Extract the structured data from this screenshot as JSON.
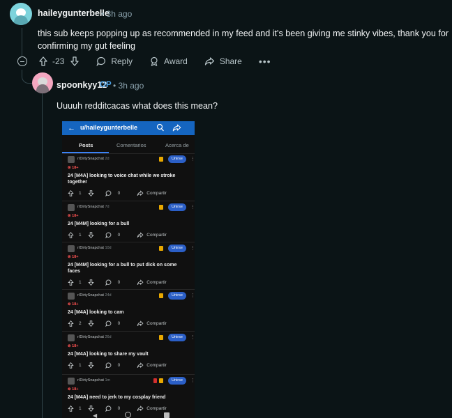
{
  "comment1": {
    "username": "haileygunterbelle",
    "time": "• 3h ago",
    "text": "this sub keeps popping up as recommended in my feed and it's been giving me stinky vibes, thank you for confirming my gut feeling",
    "score": "-23",
    "reply_label": "Reply",
    "award_label": "Award",
    "share_label": "Share",
    "more_label": "•••"
  },
  "comment2": {
    "username": "spoonkyy12",
    "op_badge": "OP",
    "time": "• 3h ago",
    "text": "Uuuuh redditcacas what does this mean?"
  },
  "screenshot": {
    "back": "←",
    "username": "u/haileygunterbelle",
    "tabs": [
      "Posts",
      "Comentarios",
      "Acerca de"
    ],
    "posts": [
      {
        "sub": "r/DirtySnapchat",
        "age": "2d",
        "nsfw": "⊗ 18+",
        "title": "24 [M4A] looking to voice chat while we stroke together",
        "votes": "1",
        "comments": "0",
        "share": "Compartir",
        "join": "Unirse"
      },
      {
        "sub": "r/DirtySnapchat",
        "age": "7d",
        "nsfw": "⊗ 18+",
        "title": "24 [M4M] looking for a bull",
        "votes": "1",
        "comments": "0",
        "share": "Compartir",
        "join": "Unirse"
      },
      {
        "sub": "r/DirtySnapchat",
        "age": "10d",
        "nsfw": "⊗ 18+",
        "title": "24 [M4M] looking for a bull to put dick on some faces",
        "votes": "1",
        "comments": "0",
        "share": "Compartir",
        "join": "Unirse"
      },
      {
        "sub": "r/DirtySnapchat",
        "age": "24d",
        "nsfw": "⊗ 18+",
        "title": "24 [M4A] looking to cam",
        "votes": "2",
        "comments": "0",
        "share": "Compartir",
        "join": "Unirse"
      },
      {
        "sub": "r/DirtySnapchat",
        "age": "26d",
        "nsfw": "⊗ 18+",
        "title": "24 [M4A] looking to share my vault",
        "votes": "1",
        "comments": "0",
        "share": "Compartir",
        "join": "Unirse"
      },
      {
        "sub": "r/DirtySnapchat",
        "age": "1m",
        "nsfw": "⊗ 18+",
        "title": "24 [M4A] need to jerk to my cosplay friend",
        "votes": "1",
        "comments": "0",
        "share": "Compartir",
        "join": "Unirse"
      }
    ]
  },
  "colors": {
    "background": "#0b1416",
    "op_blue": "#4ca1e6",
    "app_bar": "#1565c0",
    "nsfw_red": "#ff5252",
    "join_blue": "#2b5fc7",
    "lock_yellow": "#e8a800"
  },
  "icons": [
    "upvote-icon",
    "downvote-icon",
    "reply-icon",
    "award-icon",
    "share-icon",
    "collapse-icon",
    "search-icon",
    "lock-icon"
  ]
}
